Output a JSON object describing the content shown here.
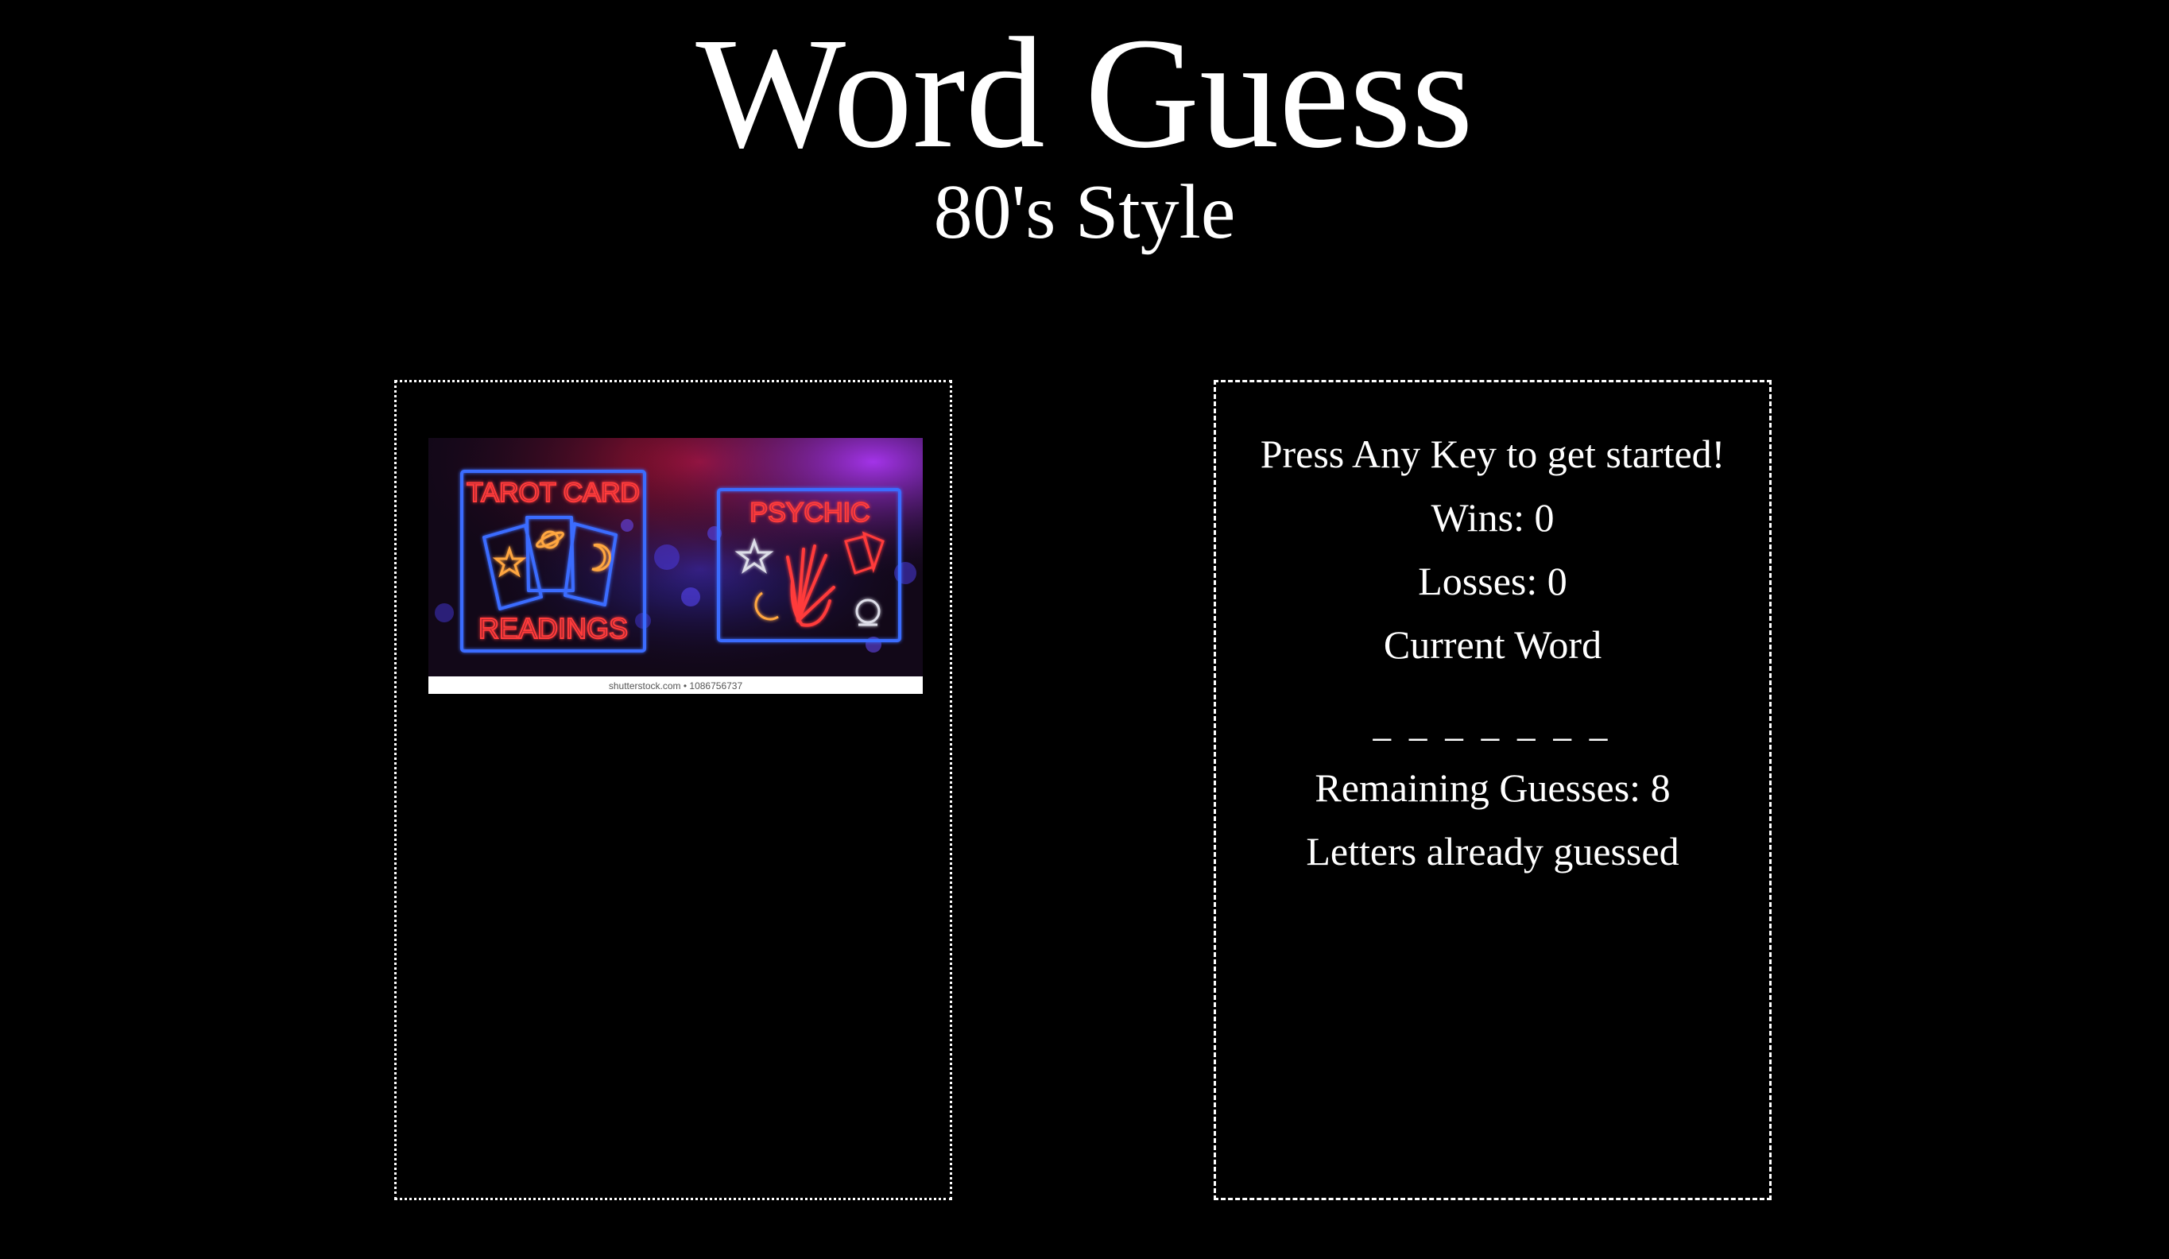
{
  "header": {
    "title": "Word Guess",
    "subtitle": "80's Style"
  },
  "left_panel": {
    "image": {
      "sign_left_top": "TAROT CARD",
      "sign_left_bottom": "READINGS",
      "sign_right_top": "PSYCHIC",
      "watermark": "shutterstock.com • 1086756737"
    }
  },
  "right_panel": {
    "prompt": "Press Any Key to get started!",
    "wins": "Wins: 0",
    "losses": "Losses: 0",
    "current_word_label": "Current Word",
    "current_word": "_ _ _ _ _ _ _",
    "remaining_guesses": "Remaining Guesses: 8",
    "letters_guessed_label": "Letters already guessed"
  },
  "colors": {
    "background": "#000000",
    "text": "#ffffff",
    "neon_red": "#ff3b3b",
    "neon_blue": "#3b6cff",
    "neon_orange": "#ffa640",
    "neon_purple": "#b038ff"
  },
  "icons": [
    "star-icon",
    "planet-icon",
    "crescent-moon-icon",
    "hand-icon",
    "crystal-ball-icon",
    "tarot-card-icon"
  ]
}
